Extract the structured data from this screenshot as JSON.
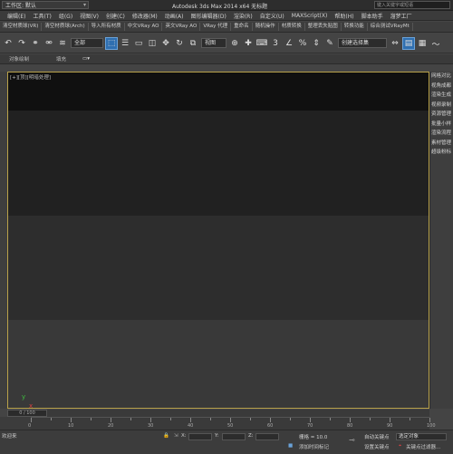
{
  "titlebar": {
    "workspace": "工作区: 默认",
    "title": "Autodesk 3ds Max  2014 x64     无标题",
    "search_placeholder": "键入关键字或短语"
  },
  "menu": [
    "编辑(E)",
    "工具(T)",
    "组(G)",
    "视图(V)",
    "创建(C)",
    "修改器(M)",
    "动画(A)",
    "图形编辑器(D)",
    "渲染(R)",
    "自定义(U)",
    "MAXScript(X)",
    "帮助(H)",
    "脚本助手",
    "溜梦工厂"
  ],
  "plugins": [
    "清空材质球(VR)",
    "清空材质球(Arch)",
    "导入所有材质",
    "中文VRay AO",
    "英文VRay AO",
    "VRay 代理",
    "重命名",
    "随机操作",
    "材质转换",
    "整理丢失贴图",
    "转换功能",
    "综合测试VRayMt"
  ],
  "main_toolbar": {
    "filter": "全部",
    "view": "视图",
    "selection_set": "创建选择集"
  },
  "subbar": {
    "left": "对象绘制",
    "mid": "填充"
  },
  "viewport": {
    "label": "[+][顶][明暗处理]",
    "axis_x": "x",
    "axis_y": "y"
  },
  "right_panel": [
    "网格对比",
    "视角成都",
    "渲染生成",
    "视频录制",
    "资源管理",
    "批量小样",
    "渲染流程",
    "素材管理",
    "超级粉标"
  ],
  "timeline": {
    "position": "0 / 100",
    "ticks": [
      "0",
      "10",
      "20",
      "30",
      "40",
      "50",
      "60",
      "70",
      "80",
      "90",
      "100"
    ]
  },
  "status": {
    "x_label": "X:",
    "y_label": "Y:",
    "z_label": "Z:",
    "grid": "栅格 = 10.0",
    "add_marker": "添加时间标记",
    "auto_key": "自动关键点",
    "set_key": "设置关键点",
    "selected": "选定对象",
    "key_filter": "关键点过滤器...",
    "script": "欢迎来"
  },
  "colors": {
    "viewport_border": "#b8a14a",
    "active_blue": "#2f6fb0"
  }
}
